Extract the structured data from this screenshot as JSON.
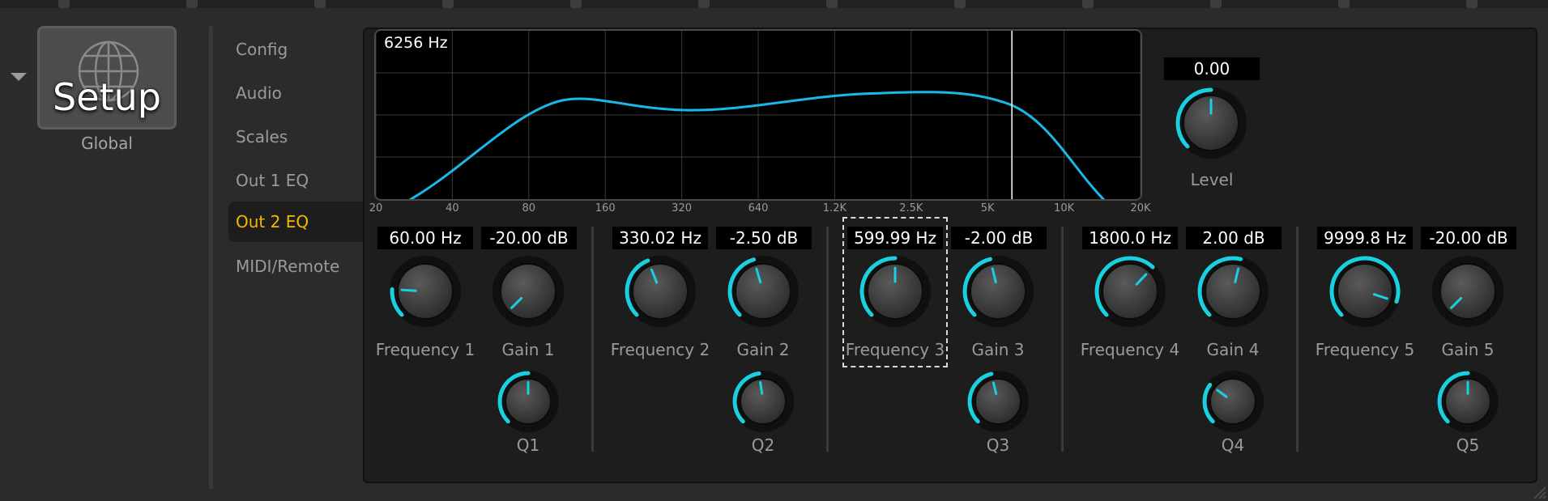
{
  "sidebar": {
    "module_title": "Setup",
    "module_caption": "Global",
    "icon": "globe-icon"
  },
  "nav": {
    "items": [
      {
        "label": "Config"
      },
      {
        "label": "Audio"
      },
      {
        "label": "Scales"
      },
      {
        "label": "Out 1 EQ"
      },
      {
        "label": "Out 2 EQ"
      },
      {
        "label": "MIDI/Remote"
      }
    ],
    "active_index": 4,
    "active_color": "#f5b800"
  },
  "graph": {
    "readout": "6256 Hz",
    "cursor_hz": 6256,
    "x_ticks": [
      "20",
      "40",
      "80",
      "160",
      "320",
      "640",
      "1.2K",
      "2.5K",
      "5K",
      "10K",
      "20K"
    ],
    "curve_color": "#1ab8e6"
  },
  "level": {
    "value": "0.00",
    "label": "Level",
    "level": 0.5
  },
  "bands": [
    {
      "freq_value": "60.00 Hz",
      "freq_label": "Frequency 1",
      "freq_level": 0.18,
      "gain_value": "-20.00 dB",
      "gain_label": "Gain 1",
      "gain_level": 0.0,
      "q_label": "Q1",
      "q_level": 0.5
    },
    {
      "freq_value": "330.02 Hz",
      "freq_label": "Frequency 2",
      "freq_level": 0.42,
      "gain_value": "-2.50 dB",
      "gain_label": "Gain 2",
      "gain_level": 0.44,
      "q_label": "Q2",
      "q_level": 0.47
    },
    {
      "freq_value": "599.99 Hz",
      "freq_label": "Frequency 3",
      "freq_level": 0.5,
      "gain_value": "-2.00 dB",
      "gain_label": "Gain 3",
      "gain_level": 0.45,
      "q_label": "Q3",
      "q_level": 0.45
    },
    {
      "freq_value": "1800.0 Hz",
      "freq_label": "Frequency 4",
      "freq_level": 0.66,
      "gain_value": "2.00 dB",
      "gain_label": "Gain 4",
      "gain_level": 0.55,
      "q_label": "Q4",
      "q_level": 0.3
    },
    {
      "freq_value": "9999.8 Hz",
      "freq_label": "Frequency 5",
      "freq_level": 0.9,
      "gain_value": "-20.00 dB",
      "gain_label": "Gain 5",
      "gain_level": 0.0,
      "q_label": "Q5",
      "q_level": 0.5
    }
  ],
  "colors": {
    "accent": "#1ad0e0",
    "knob_body": "#3a3a3a",
    "panel_bg": "#1d1d1d"
  }
}
